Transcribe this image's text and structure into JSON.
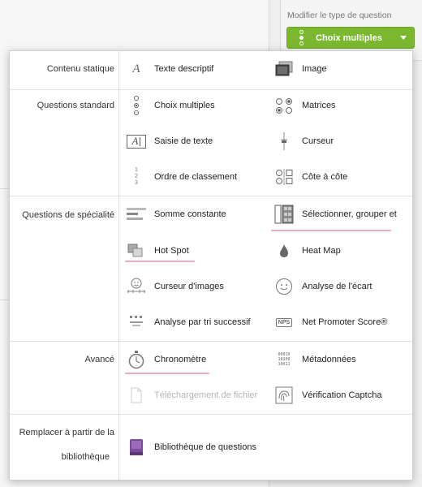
{
  "header": {
    "question_type_label": "Modifier le type de question",
    "question_type_value": "Choix multiples"
  },
  "menu": {
    "categories": {
      "static": "Contenu statique",
      "standard": "Questions standard",
      "specialty": "Questions de spécialité",
      "advanced": "Avancé",
      "library_line1": "Remplacer à partir de la",
      "library_line2": "bibliothèque"
    },
    "items": {
      "descriptive_text": "Texte descriptif",
      "image": "Image",
      "multiple_choice": "Choix multiples",
      "matrix": "Matrices",
      "text_entry": "Saisie de texte",
      "slider": "Curseur",
      "rank_order": "Ordre de classement",
      "side_by_side": "Côte à côte",
      "constant_sum": "Somme constante",
      "pick_group_rank": "Sélectionner, grouper et",
      "hot_spot": "Hot Spot",
      "heat_map": "Heat Map",
      "graphic_slider": "Curseur d'images",
      "gap_analysis": "Analyse de l'écart",
      "maxdiff": "Analyse par tri successif",
      "nps": "Net Promoter Score®",
      "timing": "Chronomètre",
      "meta_info": "Métadonnées",
      "file_upload": "Téléchargement de fichier",
      "captcha": "Vérification Captcha",
      "question_library": "Bibliothèque de questions"
    },
    "icon_text": {
      "text_entry": "A",
      "rank_numbers": "1\n2\n3",
      "nps": "NPS",
      "meta": "00010\n10100\n10011"
    },
    "colors": {
      "highlight_underline": "#f0aac2",
      "accent_green": "#7cb82f",
      "library_purple": "#7b4a9a"
    }
  }
}
